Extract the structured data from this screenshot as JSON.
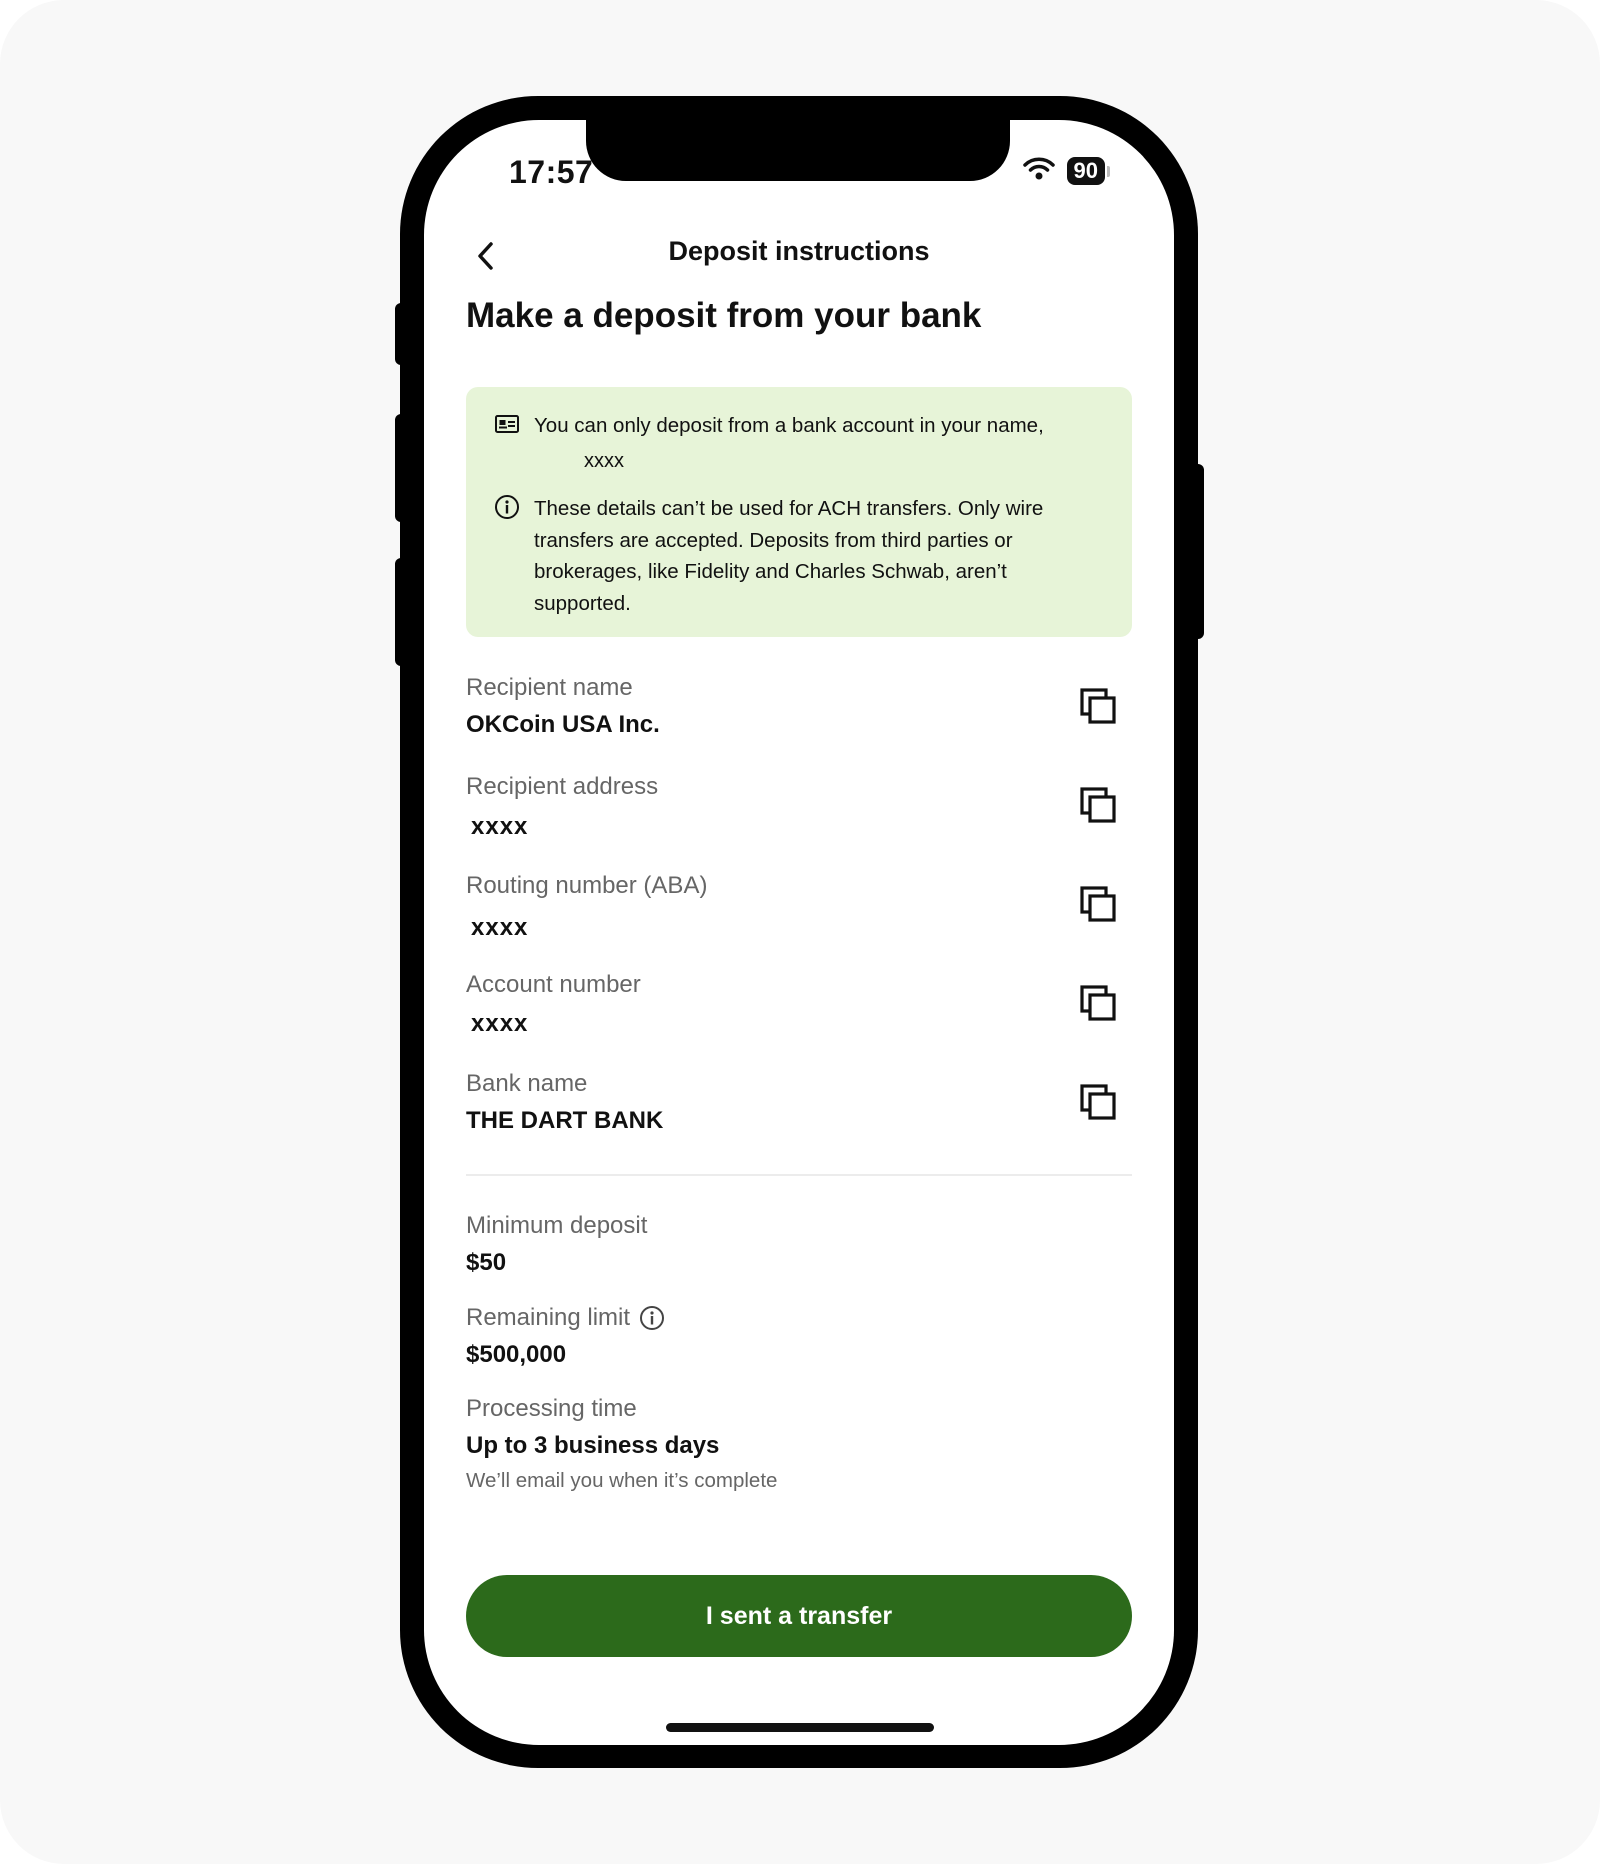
{
  "status_bar": {
    "time": "17:57",
    "battery": "90"
  },
  "nav": {
    "title": "Deposit instructions",
    "back_icon": "chevron-left-icon"
  },
  "page": {
    "title": "Make a deposit from your bank"
  },
  "notice": {
    "background_color": "#e7f4d8",
    "name_notice": "You can only deposit from a bank account in your name,",
    "name_value": "xxxx",
    "wire_notice": "These details can’t be used for ACH transfers. Only wire transfers are accepted. Deposits from third parties or brokerages, like Fidelity and Charles Schwab, aren’t supported."
  },
  "fields": [
    {
      "label": "Recipient name",
      "value": "OKCoin USA Inc."
    },
    {
      "label": "Recipient address",
      "value": "xxxx"
    },
    {
      "label": "Routing number (ABA)",
      "value": "xxxx"
    },
    {
      "label": "Account number",
      "value": "xxxx"
    },
    {
      "label": "Bank name",
      "value": "THE DART BANK"
    }
  ],
  "details": {
    "minimum_label": "Minimum deposit",
    "minimum_value": "$50",
    "limit_label": "Remaining limit",
    "limit_value": "$500,000",
    "processing_label": "Processing time",
    "processing_value": "Up to 3 business days",
    "processing_note": "We’ll email you when it’s complete"
  },
  "actions": {
    "primary_label": "I sent a transfer",
    "primary_color": "#2c6a1b"
  }
}
